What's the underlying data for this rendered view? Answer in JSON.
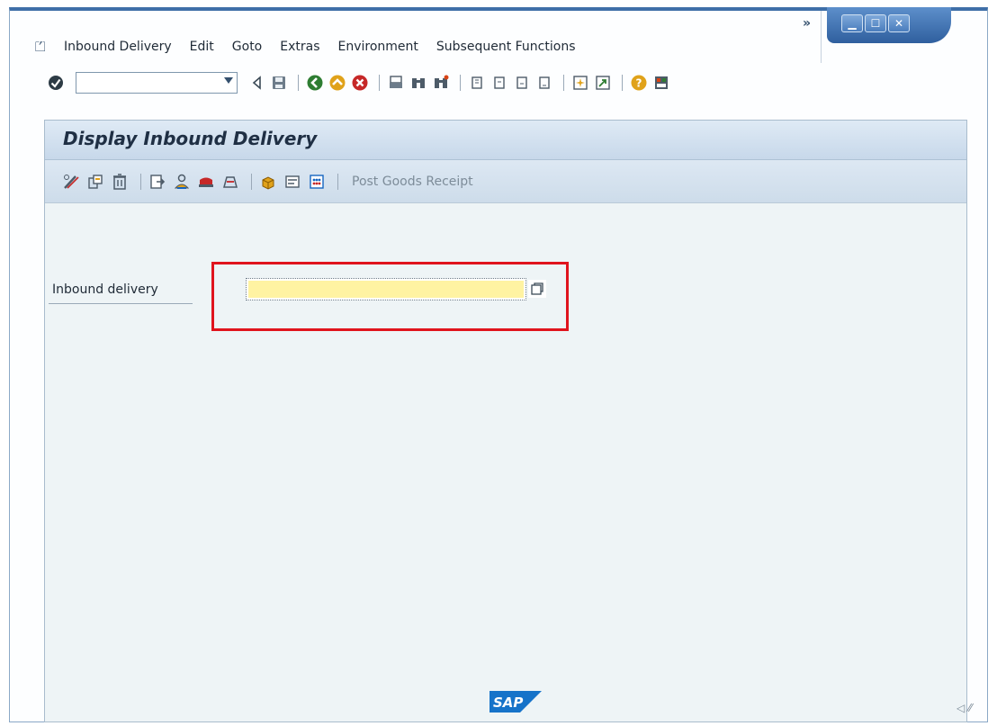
{
  "menu": {
    "items": [
      "Inbound Delivery",
      "Edit",
      "Goto",
      "Extras",
      "Environment",
      "Subsequent Functions"
    ],
    "overflow": "»"
  },
  "window_controls": {
    "minimize": "▁",
    "maximize": "☐",
    "close": "✕"
  },
  "command_field": {
    "value": ""
  },
  "screen": {
    "title": "Display Inbound Delivery",
    "post_goods_receipt_label": "Post Goods Receipt"
  },
  "form": {
    "inbound_delivery_label": "Inbound delivery",
    "inbound_delivery_value": ""
  },
  "footer": {
    "logo_text": "SAP"
  },
  "colors": {
    "highlight": "#e0141d",
    "required_field": "#fff3a2",
    "panel_bg": "#eef4f6",
    "title_bar": "#3f6fa8"
  }
}
